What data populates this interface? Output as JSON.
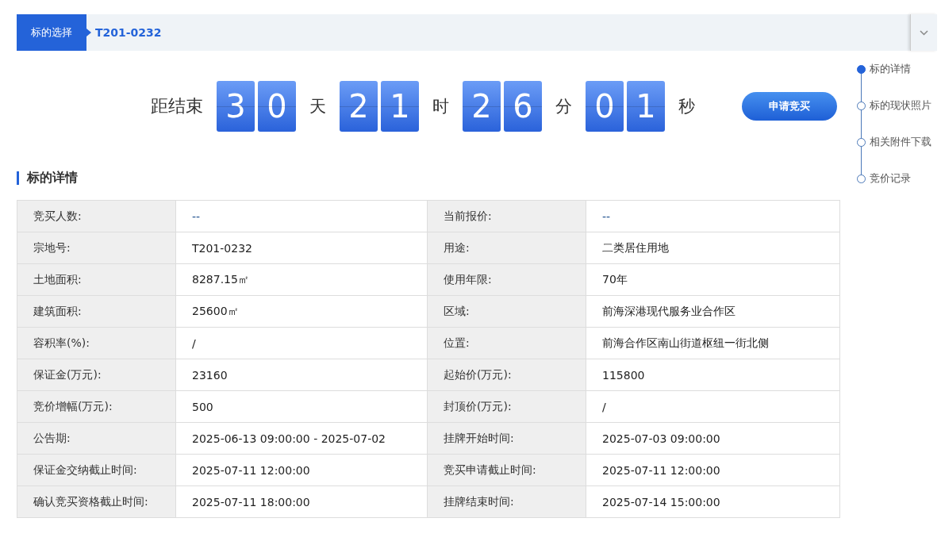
{
  "selector": {
    "label": "标的选择",
    "value": "T201-0232"
  },
  "countdown": {
    "label": "距结束",
    "groups": [
      {
        "digits": [
          "3",
          "0"
        ],
        "unit": "天"
      },
      {
        "digits": [
          "2",
          "1"
        ],
        "unit": "时"
      },
      {
        "digits": [
          "2",
          "6"
        ],
        "unit": "分"
      },
      {
        "digits": [
          "0",
          "1"
        ],
        "unit": "秒"
      }
    ]
  },
  "apply_button": "申请竞买",
  "section_title": "标的详情",
  "details": [
    [
      {
        "label": "竞买人数:",
        "value": "--",
        "kind": "placeholder"
      },
      {
        "label": "当前报价:",
        "value": "--",
        "kind": "placeholder"
      }
    ],
    [
      {
        "label": "宗地号:",
        "value": "T201-0232",
        "kind": "text"
      },
      {
        "label": "用途:",
        "value": "二类居住用地",
        "kind": "text"
      }
    ],
    [
      {
        "label": "土地面积:",
        "value": "8287.15㎡",
        "kind": "text"
      },
      {
        "label": "使用年限:",
        "value": "70年",
        "kind": "text"
      }
    ],
    [
      {
        "label": "建筑面积:",
        "value": "25600㎡",
        "kind": "text"
      },
      {
        "label": "区域:",
        "value": "前海深港现代服务业合作区",
        "kind": "text"
      }
    ],
    [
      {
        "label": "容积率(%):",
        "value": "/",
        "kind": "text"
      },
      {
        "label": "位置:",
        "value": "前海合作区南山街道枢纽一街北侧",
        "kind": "text"
      }
    ],
    [
      {
        "label": "保证金(万元):",
        "value": "23160",
        "kind": "text"
      },
      {
        "label": "起始价(万元):",
        "value": "115800",
        "kind": "text"
      }
    ],
    [
      {
        "label": "竞价增幅(万元):",
        "value": "500",
        "kind": "text"
      },
      {
        "label": "封顶价(万元):",
        "value": "/",
        "kind": "text"
      }
    ],
    [
      {
        "label": "公告期:",
        "value": "2025-06-13 09:00:00 - 2025-07-02",
        "kind": "text"
      },
      {
        "label": "挂牌开始时间:",
        "value": "2025-07-03 09:00:00",
        "kind": "text"
      }
    ],
    [
      {
        "label": "保证金交纳截止时间:",
        "value": "2025-07-11 12:00:00",
        "kind": "text"
      },
      {
        "label": "竞买申请截止时间:",
        "value": "2025-07-11 12:00:00",
        "kind": "text"
      }
    ],
    [
      {
        "label": "确认竞买资格截止时间:",
        "value": "2025-07-11 18:00:00",
        "kind": "text"
      },
      {
        "label": "挂牌结束时间:",
        "value": "2025-07-14 15:00:00",
        "kind": "text"
      }
    ]
  ],
  "nav": [
    {
      "label": "标的详情",
      "selected": true
    },
    {
      "label": "标的现状照片",
      "selected": false
    },
    {
      "label": "相关附件下载",
      "selected": false
    },
    {
      "label": "竞价记录",
      "selected": false
    }
  ]
}
